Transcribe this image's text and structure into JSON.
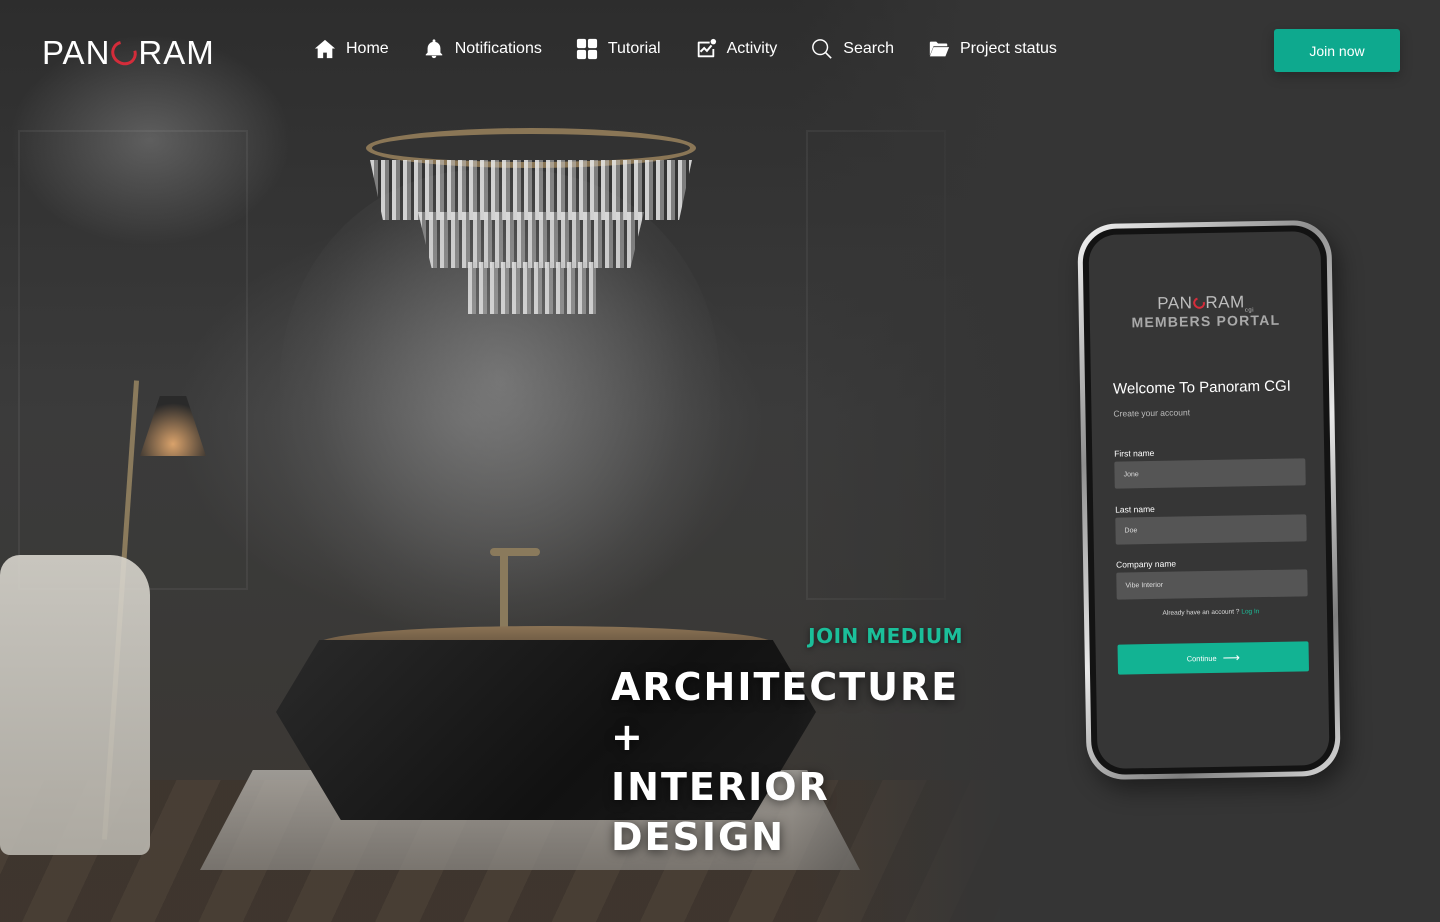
{
  "brand": {
    "logo_left": "PAN",
    "logo_right": "RAM",
    "accent_color": "#0ea98e",
    "logo_accent_color": "#d42c3a"
  },
  "nav": {
    "items": [
      {
        "label": "Home",
        "icon": "home-icon"
      },
      {
        "label": "Notifications",
        "icon": "bell-icon"
      },
      {
        "label": "Tutorial",
        "icon": "grid-icon"
      },
      {
        "label": "Activity",
        "icon": "activity-chart-icon"
      },
      {
        "label": "Search",
        "icon": "search-icon"
      },
      {
        "label": "Project status",
        "icon": "folder-icon"
      }
    ],
    "join_label": "Join now"
  },
  "hero": {
    "eyebrow": "JOIN MEDIUM",
    "headline_line1": "ARCHITECTURE +",
    "headline_line2": "INTERIOR DESIGN"
  },
  "phone": {
    "logo_left": "PAN",
    "logo_right": "RAM",
    "logo_sub": "cgi",
    "portal_title": "MEMBERS PORTAL",
    "welcome": "Welcome To Panoram CGI",
    "subtitle": "Create your account",
    "fields": [
      {
        "label": "First name",
        "value": "Jone"
      },
      {
        "label": "Last name",
        "value": "Doe"
      },
      {
        "label": "Company name",
        "value": "Vibe Interior"
      }
    ],
    "already_text": "Already have an account ?",
    "login_link": "Log In",
    "continue_label": "Continue"
  }
}
